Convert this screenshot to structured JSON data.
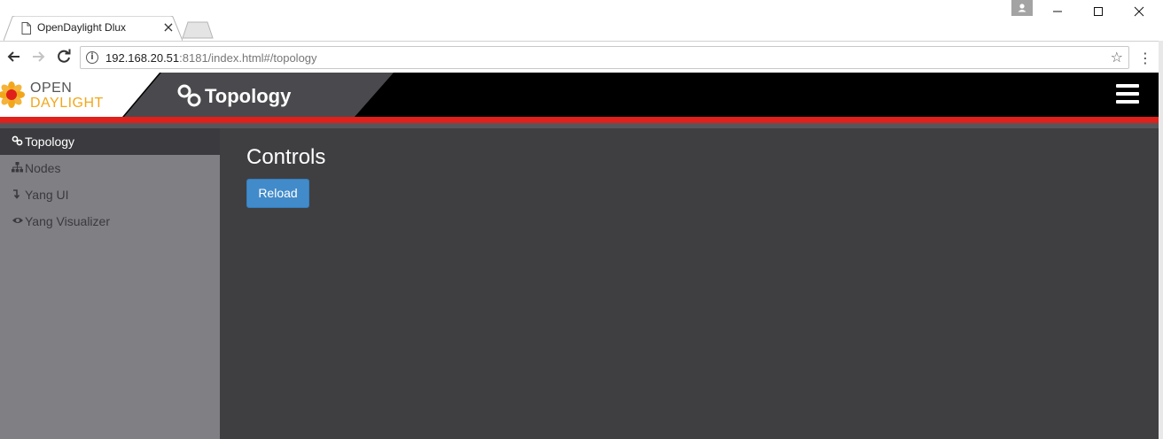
{
  "browser": {
    "tab_title": "OpenDaylight Dlux",
    "tab_close_glyph": "×",
    "url_host": "192.168.20.51",
    "url_rest": ":8181/index.html#/topology",
    "icons": [
      "document-icon",
      "back-arrow-icon",
      "forward-arrow-icon",
      "reload-icon",
      "info-icon",
      "star-icon",
      "kebab-menu-icon",
      "user-icon",
      "minimize-icon",
      "maximize-icon",
      "close-icon"
    ]
  },
  "app": {
    "logo_open": "OPEN",
    "logo_daylight": "DAYLIGHT",
    "page_title": "Topology",
    "colors": {
      "header": "#000000",
      "accent_red": "#e0201a",
      "logo_orange": "#f2a71b",
      "button_blue": "#428bca",
      "content_bg": "#3f3f42",
      "sidebar_bg": "#7f7f84"
    }
  },
  "sidebar": {
    "items": [
      {
        "label": "Topology",
        "icon": "link-icon",
        "active": true
      },
      {
        "label": "Nodes",
        "icon": "sitemap-icon",
        "active": false
      },
      {
        "label": "Yang UI",
        "icon": "arrow-turn-icon",
        "active": false
      },
      {
        "label": "Yang Visualizer",
        "icon": "eye-icon",
        "active": false
      }
    ]
  },
  "main": {
    "heading": "Controls",
    "reload_label": "Reload"
  }
}
